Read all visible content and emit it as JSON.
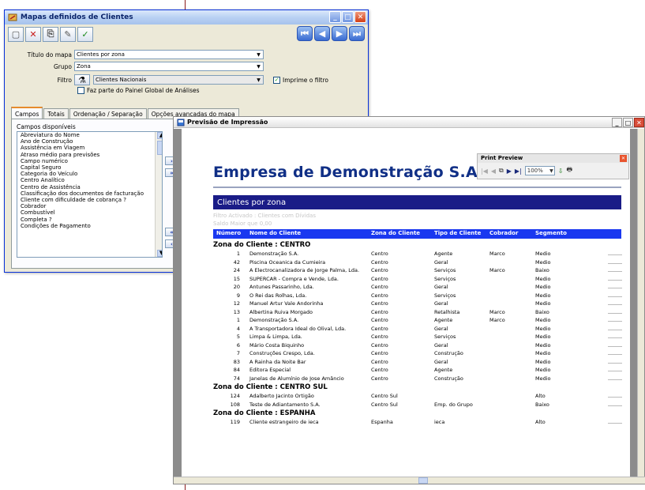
{
  "win1": {
    "title": "Mapas definidos de Clientes",
    "fields": {
      "titulo_label": "Título do mapa",
      "titulo_value": "Clientes por zona",
      "grupo_label": "Grupo",
      "grupo_value": "Zona",
      "filtro_label": "Filtro",
      "filtro_value": "Clientes Nacionais",
      "imprime_filtro": "Imprime o filtro",
      "painel_global": "Faz parte do Painel Global de Análises"
    },
    "tabs": [
      "Campos",
      "Totais",
      "Ordenação / Separação",
      "Opções avançadas do mapa"
    ],
    "campos_label": "Campos disponíveis",
    "campos_label2": "C",
    "campos": [
      "Abreviatura do Nome",
      "Ano de Construção",
      "Assistência em Viagem",
      "Atraso médio para previsões",
      "Campo numérico",
      "Capital Seguro",
      "Categoria do Veículo",
      "Centro Analítico",
      "Centro de Assistência",
      "Classificação dos documentos de facturação",
      "Cliente com dificuldade de cobrança ?",
      "Cobrador",
      "Combustível",
      "Completa ?",
      "Condições de Pagamento"
    ]
  },
  "win2": {
    "title": "Previsão de Impressão",
    "print_preview": {
      "title": "Print Preview",
      "zoom": "100%"
    },
    "company": "Empresa de Demonstração S.A.",
    "report_title": "Clientes por zona",
    "filter_lines": [
      "Filtro Activado : Clientes com Dívidas",
      "Saldo Maior que 0,00"
    ],
    "columns": [
      "Número",
      "Nome do Cliente",
      "Zona do Cliente",
      "Tipo de Cliente",
      "Cobrador",
      "Segmento"
    ],
    "groups": [
      {
        "title": "Zona do Cliente : CENTRO",
        "rows": [
          [
            "1",
            "Demonstração S.A.",
            "Centro",
            "Agente",
            "Marco",
            "Medio"
          ],
          [
            "42",
            "Piscina Oceanica da Cumieira",
            "Centro",
            "Geral",
            "",
            "Medio"
          ],
          [
            "24",
            "A Electrocanalizadora de Jorge Palma, Lda.",
            "Centro",
            "Serviços",
            "Marco",
            "Baixo"
          ],
          [
            "15",
            "SUPERCAR - Compra e Vende, Lda.",
            "Centro",
            "Serviços",
            "",
            "Medio"
          ],
          [
            "20",
            "Antunes Passarinho, Lda.",
            "Centro",
            "Geral",
            "",
            "Medio"
          ],
          [
            "9",
            "O Rei das Rolhas, Lda.",
            "Centro",
            "Serviços",
            "",
            "Medio"
          ],
          [
            "12",
            "Manuel Artur Vale Andorinha",
            "Centro",
            "Geral",
            "",
            "Medio"
          ],
          [
            "13",
            "Albertina Ruiva Morgado",
            "Centro",
            "Retalhista",
            "Marco",
            "Baixo"
          ],
          [
            "1",
            "Demonstração S.A.",
            "Centro",
            "Agente",
            "Marco",
            "Medio"
          ],
          [
            "4",
            "A Transportadora Ideal do Olival, Lda.",
            "Centro",
            "Geral",
            "",
            "Medio"
          ],
          [
            "5",
            "Limpa & Limpa, Lda.",
            "Centro",
            "Serviços",
            "",
            "Medio"
          ],
          [
            "6",
            "Mário Costa Biquinho",
            "Centro",
            "Geral",
            "",
            "Medio"
          ],
          [
            "7",
            "Construções Crespo, Lda.",
            "Centro",
            "Construção",
            "",
            "Medio"
          ],
          [
            "83",
            "A Rainha da Noite Bar",
            "Centro",
            "Geral",
            "",
            "Medio"
          ],
          [
            "84",
            "Editora Especial",
            "Centro",
            "Agente",
            "",
            "Medio"
          ],
          [
            "74",
            "Janelas de Alumínio de Jose Amâncio",
            "Centro",
            "Construção",
            "",
            "Medio"
          ]
        ]
      },
      {
        "title": "Zona do Cliente : CENTRO SUL",
        "rows": [
          [
            "124",
            "Adalberto Jacinto Ortigão",
            "Centro Sul",
            "",
            "",
            "Alto"
          ],
          [
            "108",
            "Teste de Adiantamento S.A.",
            "Centro Sul",
            "Emp. do Grupo",
            "",
            "Baixo"
          ]
        ]
      },
      {
        "title": "Zona do Cliente : ESPANHA",
        "rows": [
          [
            "119",
            "Cliente estrangeiro de ieca",
            "Espanha",
            "ieca",
            "",
            "Alto"
          ]
        ]
      }
    ]
  }
}
